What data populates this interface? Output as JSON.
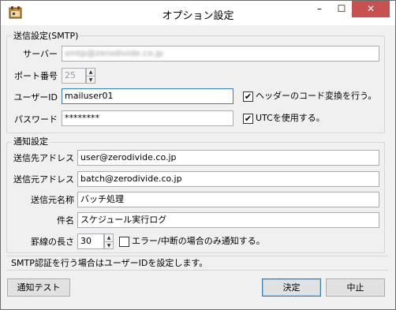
{
  "window": {
    "title": "オプション設定",
    "minimize": "–",
    "maximize": "☐",
    "close": "✕"
  },
  "smtp": {
    "legend": "送信設定(SMTP)",
    "server_label": "サーバー",
    "server_value": "smtp@zerodivide.co.jp",
    "port_label": "ポート番号",
    "port_value": "25",
    "user_label": "ユーザーID",
    "user_value": "mailuser01",
    "password_label": "パスワード",
    "password_value": "********",
    "header_check_label": "ヘッダーのコード変換を行う。",
    "header_checked": true,
    "utc_check_label": "UTCを使用する。",
    "utc_checked": true
  },
  "notify": {
    "legend": "通知設定",
    "to_label": "送信先アドレス",
    "to_value": "user@zerodivide.co.jp",
    "from_label": "送信元アドレス",
    "from_value": "batch@zerodivide.co.jp",
    "from_name_label": "送信元名称",
    "from_name_value": "バッチ処理",
    "subject_label": "件名",
    "subject_value": "スケジュール実行ログ",
    "rule_label": "罫線の長さ",
    "rule_value": "30",
    "error_only_label": "エラー/中断の場合のみ通知する。",
    "error_only_checked": false
  },
  "status_text": "SMTP認証を行う場合はユーザーIDを設定します。",
  "buttons": {
    "test": "通知テスト",
    "ok": "決定",
    "cancel": "中止"
  }
}
